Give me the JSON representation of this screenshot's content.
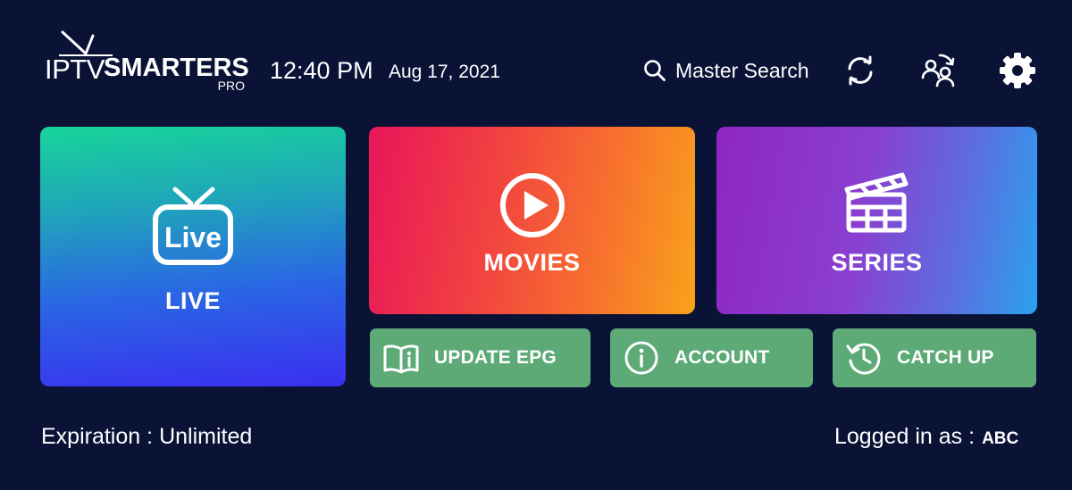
{
  "header": {
    "logo": {
      "part1": "IPTV",
      "part2": "SMARTERS",
      "part3": "PRO"
    },
    "time": "12:40 PM",
    "date": "Aug 17, 2021",
    "search_label": "Master Search",
    "icons": [
      "search-icon",
      "reload-icon",
      "switch-users-icon",
      "gear-icon"
    ]
  },
  "tiles": {
    "live": {
      "label": "LIVE",
      "icon_text": "Live",
      "icon": "live-tv-icon"
    },
    "movies": {
      "label": "MOVIES",
      "icon": "play-circle-icon"
    },
    "series": {
      "label": "SERIES",
      "icon": "clapperboard-icon"
    }
  },
  "buttons": {
    "update_epg": {
      "label": "UPDATE EPG",
      "icon": "book-info-icon"
    },
    "account": {
      "label": "ACCOUNT",
      "icon": "info-circle-icon"
    },
    "catch_up": {
      "label": "CATCH UP",
      "icon": "history-clock-icon"
    }
  },
  "footer": {
    "expiration_label": "Expiration :",
    "expiration_value": "Unlimited",
    "logged_label": "Logged in as :",
    "logged_user": "ABC"
  },
  "colors": {
    "background": "#0a1236",
    "small_button": "#5daa77",
    "text": "#ffffff"
  }
}
